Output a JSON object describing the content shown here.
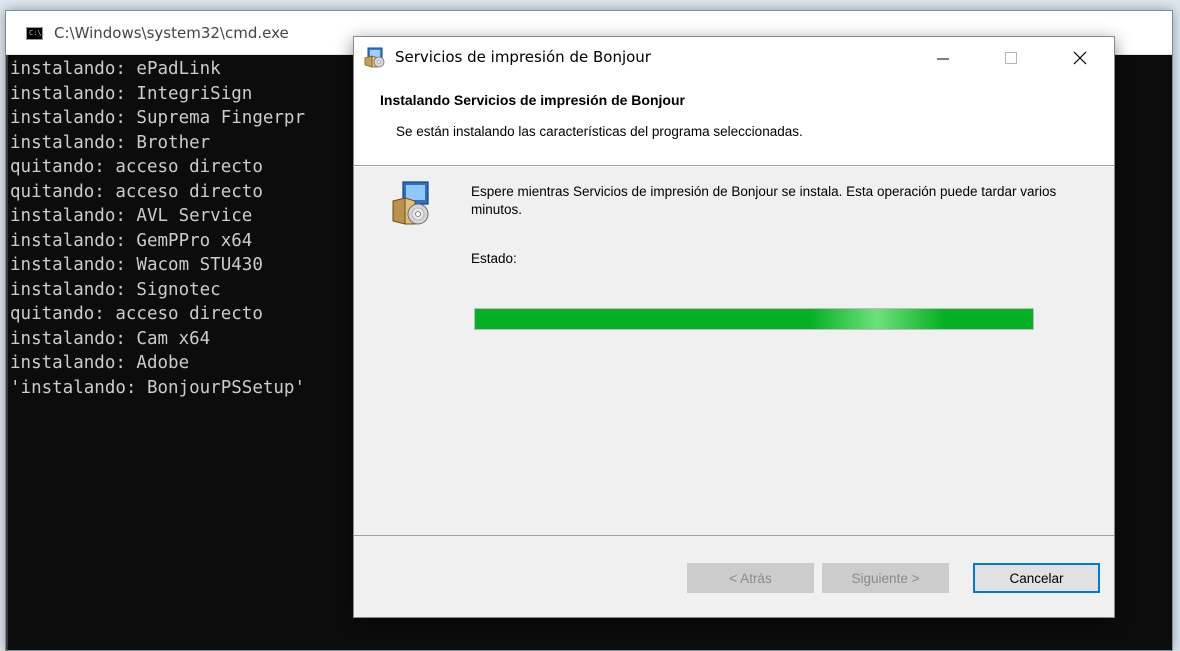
{
  "cmd": {
    "title": "C:\\Windows\\system32\\cmd.exe",
    "icon_text": "C:\\.",
    "lines": [
      "instalando: ePadLink",
      "instalando: IntegriSign",
      "instalando: Suprema Fingerpr",
      "instalando: Brother",
      "quitando: acceso directo",
      "quitando: acceso directo",
      "instalando: AVL Service",
      "instalando: GemPPro x64",
      "instalando: Wacom STU430",
      "instalando: Signotec",
      "quitando: acceso directo",
      "instalando: Cam x64",
      "instalando: Adobe",
      "'instalando: BonjourPSSetup'"
    ]
  },
  "dialog": {
    "title": "Servicios de impresión de Bonjour",
    "header_title": "Instalando Servicios de impresión de Bonjour",
    "header_subtitle": "Se están instalando las características del programa seleccionadas.",
    "message": "Espere mientras Servicios de impresión de Bonjour se instala. Esta operación puede tardar varios minutos.",
    "status_label": "Estado:",
    "progress_fraction": 1.0,
    "buttons": {
      "back": "< Atrás",
      "next": "Siguiente >",
      "cancel": "Cancelar"
    },
    "accent_color": "#0078d7",
    "progress_color": "#06b025"
  }
}
